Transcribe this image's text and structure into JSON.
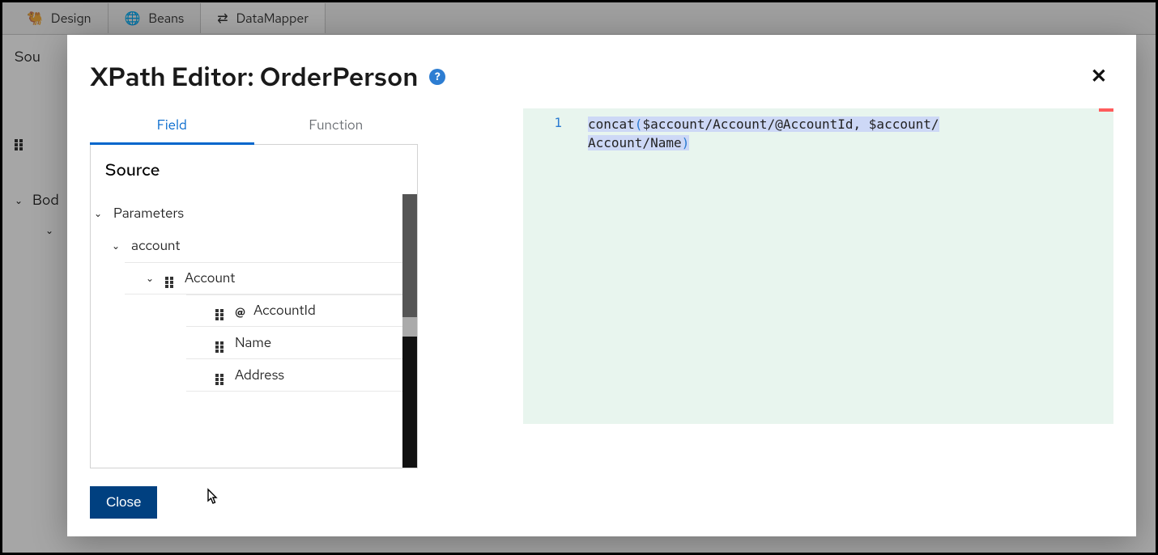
{
  "bg": {
    "tabs": [
      {
        "label": "Design",
        "icon": "🐫"
      },
      {
        "label": "Beans",
        "icon": "🌐"
      },
      {
        "label": "DataMapper",
        "icon": "⇄"
      }
    ],
    "left": {
      "source": "Sou",
      "body": "Bod"
    }
  },
  "modal": {
    "title": "XPath Editor: OrderPerson",
    "help": "?",
    "close": "✕",
    "tabs": {
      "field": "Field",
      "function": "Function"
    },
    "source_heading": "Source",
    "tree": {
      "parameters": "Parameters",
      "account": "account",
      "Account": "Account",
      "AccountId": "AccountId",
      "Name": "Name",
      "Address": "Address"
    },
    "code": {
      "line_no": "1",
      "tokens": {
        "fn": "concat",
        "lp": "(",
        "arg1": "$account/Account/@AccountId",
        "comma": ", ",
        "arg2a": "$account/",
        "arg2b": "Account/Name",
        "rp": ")"
      }
    },
    "close_btn": "Close"
  }
}
